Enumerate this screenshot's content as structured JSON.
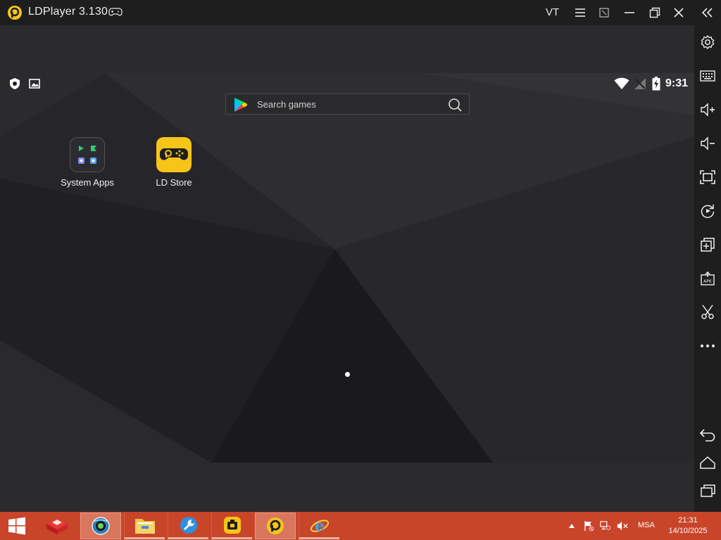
{
  "titlebar": {
    "app_title": "LDPlayer 3.130",
    "vt_label": "VT",
    "controls": [
      "menu-icon",
      "restore-window-icon",
      "minimize-icon",
      "maximize-icon",
      "close-icon",
      "collapse-sidebar-icon"
    ]
  },
  "statusbar": {
    "time": "9:31",
    "left_icons": [
      "shield-icon",
      "image-icon"
    ],
    "right_icons": [
      "wifi-icon",
      "no-signal-icon",
      "battery-charging-icon"
    ]
  },
  "search": {
    "placeholder": "Search games"
  },
  "apps": [
    {
      "label": "System Apps",
      "icon": "system-apps-folder-icon"
    },
    {
      "label": "LD Store",
      "icon": "ld-store-icon"
    }
  ],
  "sidebar": {
    "buttons": [
      "settings-icon",
      "keyboard-icon",
      "volume-up-icon",
      "volume-down-icon",
      "fullscreen-icon",
      "rotate-icon",
      "multi-instance-icon",
      "apk-install-icon",
      "screenshot-scissors-icon",
      "more-icon",
      "back-icon",
      "home-icon",
      "recent-apps-icon"
    ]
  },
  "taskbar": {
    "items": [
      "start-icon",
      "toolbox-icon",
      "network-globe-icon",
      "file-explorer-icon",
      "tools-wrench-icon",
      "ld-multiplayer-icon",
      "ldplayer-icon",
      "internet-explorer-icon"
    ],
    "tray_icons": [
      "tray-up-arrow-icon",
      "action-center-flag-icon",
      "network-icon",
      "volume-muted-icon"
    ],
    "language": "MSA",
    "clock_time": "21:31",
    "clock_date": "14/10/2025"
  },
  "colors": {
    "taskbar": "#c8452a",
    "ld_yellow": "#f6c518",
    "titlebar": "#1e1e1f"
  }
}
